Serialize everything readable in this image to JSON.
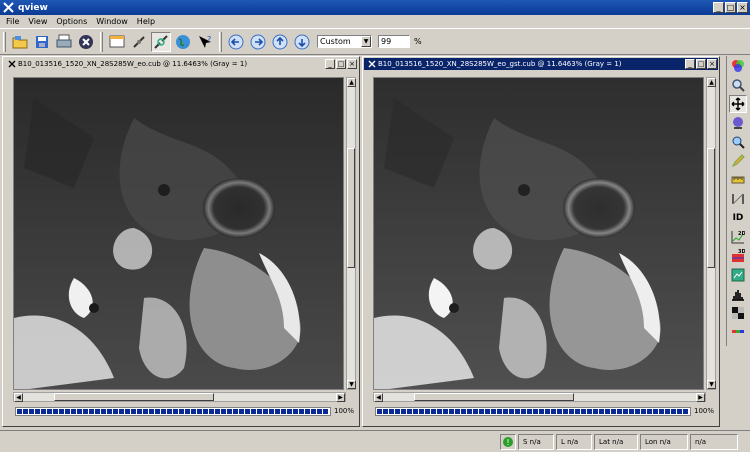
{
  "window": {
    "title": "qview"
  },
  "menu": {
    "file": "File",
    "view": "View",
    "options": "Options",
    "window": "Window",
    "help": "Help"
  },
  "toolbar": {
    "zoom_mode": "Custom",
    "zoom_value": "99",
    "zoom_unit": "%",
    "icons": [
      "open-icon",
      "save-icon",
      "print-icon",
      "close-icon",
      "blink-icon",
      "link-icon",
      "linked-icon",
      "globe-icon",
      "whats-this-icon",
      "back-icon",
      "forward-icon",
      "up-icon",
      "down-icon"
    ]
  },
  "viewports": [
    {
      "title": "B10_013516_1520_XN_28S285W_eo.cub @ 11.6463% (Gray = 1)",
      "progress": "100%",
      "progress_value": 1.0,
      "active": false
    },
    {
      "title": "B10_013516_1520_XN_28S285W_eo_gst.cub @ 11.6463% (Gray = 1)",
      "progress": "100%",
      "progress_value": 1.0,
      "active": true
    }
  ],
  "tools": [
    "band-select-icon",
    "zoom-icon",
    "pan-icon",
    "stretch-icon",
    "find-icon",
    "edit-icon",
    "measure-icon",
    "stereo-icon",
    "id-tool-icon",
    "plot-2d-icon",
    "plot-3d-icon",
    "spectral-icon",
    "histogram-icon",
    "matrix-icon",
    "color-icon"
  ],
  "tool_labels": {
    "id": "ID",
    "plot2d": "2D",
    "plot3d": "3D"
  },
  "statusbar": {
    "sample": "S n/a",
    "line": "L n/a",
    "lat": "Lat n/a",
    "lon": "Lon n/a",
    "value": "n/a"
  },
  "colors": {
    "title_active": "#0a246a",
    "progress": "#0a2a96",
    "face": "#d4d0c8"
  }
}
